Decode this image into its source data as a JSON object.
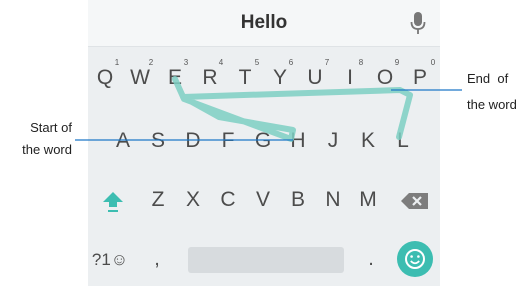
{
  "suggestion": {
    "word": "Hello"
  },
  "keyboard": {
    "hints": [
      "1",
      "2",
      "3",
      "4",
      "5",
      "6",
      "7",
      "8",
      "9",
      "0"
    ],
    "row1": [
      "Q",
      "W",
      "E",
      "R",
      "T",
      "Y",
      "U",
      "I",
      "O",
      "P"
    ],
    "row2": [
      "A",
      "S",
      "D",
      "F",
      "G",
      "H",
      "J",
      "K",
      "L"
    ],
    "row3": [
      "Z",
      "X",
      "C",
      "V",
      "B",
      "N",
      "M"
    ],
    "bottom": {
      "symbols": "?1☺",
      "comma": ",",
      "period": "."
    }
  },
  "annotations": {
    "start_line1": "Start of",
    "start_line2": "the word",
    "end_line1": "End  of",
    "end_line2": "the word"
  },
  "colors": {
    "accent": "#3cbdb1",
    "keyboard_bg": "#eceff1",
    "key_text": "#4c4c4c"
  },
  "icons": {
    "mic": "microphone-icon",
    "shift": "shift-up-arrow-icon",
    "backspace": "backspace-x-icon",
    "emoji": "smiley-face-icon"
  }
}
